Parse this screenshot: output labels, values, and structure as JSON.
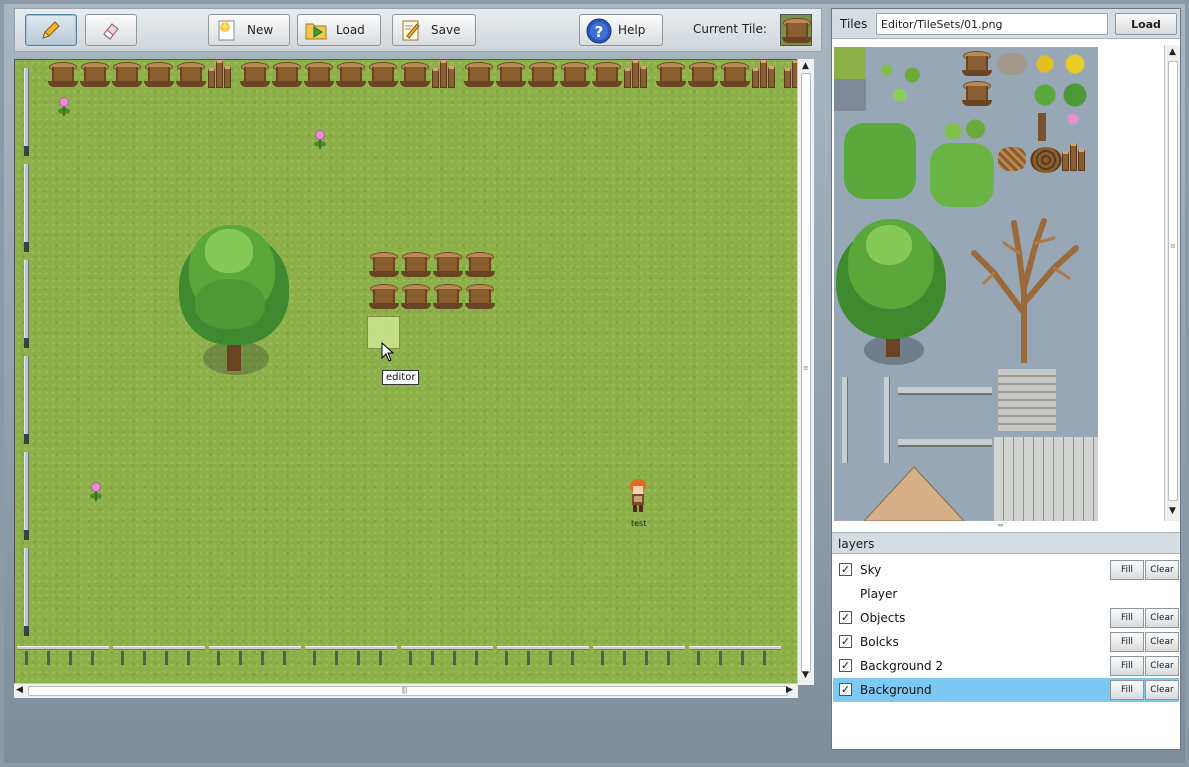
{
  "toolbar": {
    "pencil_label": "",
    "eraser_label": "",
    "new_label": "New",
    "load_label": "Load",
    "save_label": "Save",
    "help_label": "Help",
    "current_tile_label": "Current Tile:",
    "active_tool": "pencil"
  },
  "map": {
    "tooltip": "editor",
    "player_name": "test"
  },
  "tiles_panel": {
    "title": "Tiles",
    "tileset_path": "Editor/TileSets/01.png",
    "load_label": "Load"
  },
  "layers_panel": {
    "title": "layers",
    "fill_label": "Fill",
    "clear_label": "Clear",
    "layers": [
      {
        "name": "Sky",
        "checked": true,
        "selected": false,
        "has_buttons": true
      },
      {
        "name": "Player",
        "checked": false,
        "selected": false,
        "has_buttons": false
      },
      {
        "name": "Objects",
        "checked": true,
        "selected": false,
        "has_buttons": true
      },
      {
        "name": "Bolcks",
        "checked": true,
        "selected": false,
        "has_buttons": true
      },
      {
        "name": "Background 2",
        "checked": true,
        "selected": false,
        "has_buttons": true
      },
      {
        "name": "Background",
        "checked": true,
        "selected": true,
        "has_buttons": true
      }
    ]
  },
  "colors": {
    "grass": "#8db04a",
    "selected_layer": "#7ec8f4",
    "panel_header": "#d6dde2"
  }
}
